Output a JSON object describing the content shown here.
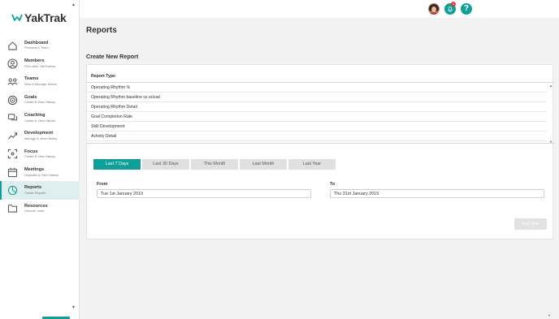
{
  "brand": {
    "name": "YakTrak"
  },
  "colors": {
    "accent": "#0f9e98",
    "active_bg": "#dfeeee",
    "badge": "#e53935",
    "button_disabled": "#e2e2e2"
  },
  "sidebar": {
    "items": [
      {
        "label": "Dashboard",
        "sub": "Personal & Team",
        "icon": "home-icon",
        "active": false
      },
      {
        "label": "Members",
        "sub": "Find other YakTrakers",
        "icon": "user-icon",
        "active": false
      },
      {
        "label": "Teams",
        "sub": "View & Manage Teams",
        "icon": "team-icon",
        "active": false
      },
      {
        "label": "Goals",
        "sub": "Create & View History",
        "icon": "target-icon",
        "active": false
      },
      {
        "label": "Coaching",
        "sub": "Create & View History",
        "icon": "chat-icon",
        "active": false
      },
      {
        "label": "Development",
        "sub": "Manage & View History",
        "icon": "trend-icon",
        "active": false
      },
      {
        "label": "Focus",
        "sub": "Create & View History",
        "icon": "focus-icon",
        "active": false
      },
      {
        "label": "Meetings",
        "sub": "Organise & View History",
        "icon": "calendar-icon",
        "active": false
      },
      {
        "label": "Reports",
        "sub": "Create Reports",
        "icon": "pie-chart-icon",
        "active": true
      },
      {
        "label": "Resources",
        "sub": "Uncover more",
        "icon": "folder-icon",
        "active": false
      }
    ]
  },
  "topbar": {
    "notification_count": "1",
    "help_label": "?"
  },
  "page": {
    "title": "Reports",
    "section_title": "Create New Report"
  },
  "report_type": {
    "label": "Report Type",
    "options": [
      "Operating Rhythm %",
      "Operating Rhythm baseline vs actual",
      "Operating Rhythm Detail",
      "Goal Completion Rate",
      "Skill Development",
      "Activity Detail"
    ]
  },
  "date_tabs": [
    {
      "label": "Last 7 Days",
      "active": true
    },
    {
      "label": "Last 30 Days",
      "active": false
    },
    {
      "label": "This Month",
      "active": false
    },
    {
      "label": "Last Month",
      "active": false
    },
    {
      "label": "Last Year",
      "active": false
    }
  ],
  "from": {
    "label": "From",
    "value": "Tue 1st January 2019"
  },
  "to": {
    "label": "To",
    "value": "Thu 31st January 2019"
  },
  "run_button": {
    "label": "Run Now"
  }
}
